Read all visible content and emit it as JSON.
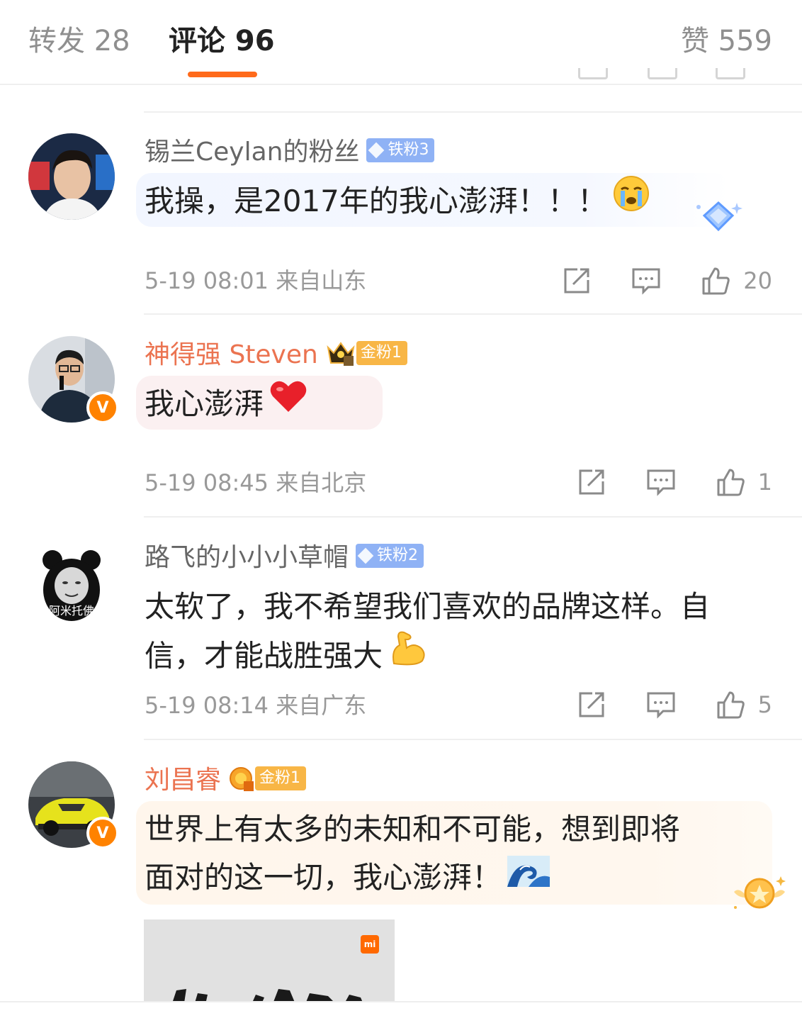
{
  "tabs": {
    "repost": "转发 28",
    "comments": "评论 96",
    "likes": "赞 559"
  },
  "colors": {
    "accent": "#ff6a1b",
    "vip_name": "#eb7350",
    "meta": "#999999"
  },
  "comments": [
    {
      "username": "锡兰Ceylan的粉丝",
      "badge": "铁粉3",
      "text": "我操，是2017年的我心澎湃！！！",
      "emoji": "crying-face",
      "time_location": "5-19 08:01  来自山东",
      "likes": "20"
    },
    {
      "username": "神得强 Steven",
      "badge": "金粉1",
      "text": "我心澎湃",
      "emoji": "red-heart",
      "time_location": "5-19 08:45  来自北京",
      "likes": "1"
    },
    {
      "username": "路飞的小小小草帽",
      "badge": "铁粉2",
      "avatar_caption": "阿米托佛",
      "text_line1": "太软了，我不希望我们喜欢的品牌这样。自",
      "text_line2": "信，才能战胜强大",
      "emoji": "flexed-biceps",
      "time_location": "5-19 08:14  来自广东",
      "likes": "5"
    },
    {
      "username": "刘昌睿",
      "badge": "金粉1",
      "text_line1": "世界上有太多的未知和不可能，想到即将",
      "text_line2": "面对的这一切，我心澎湃！",
      "emoji": "water-wave",
      "image_logo": "mi"
    }
  ]
}
